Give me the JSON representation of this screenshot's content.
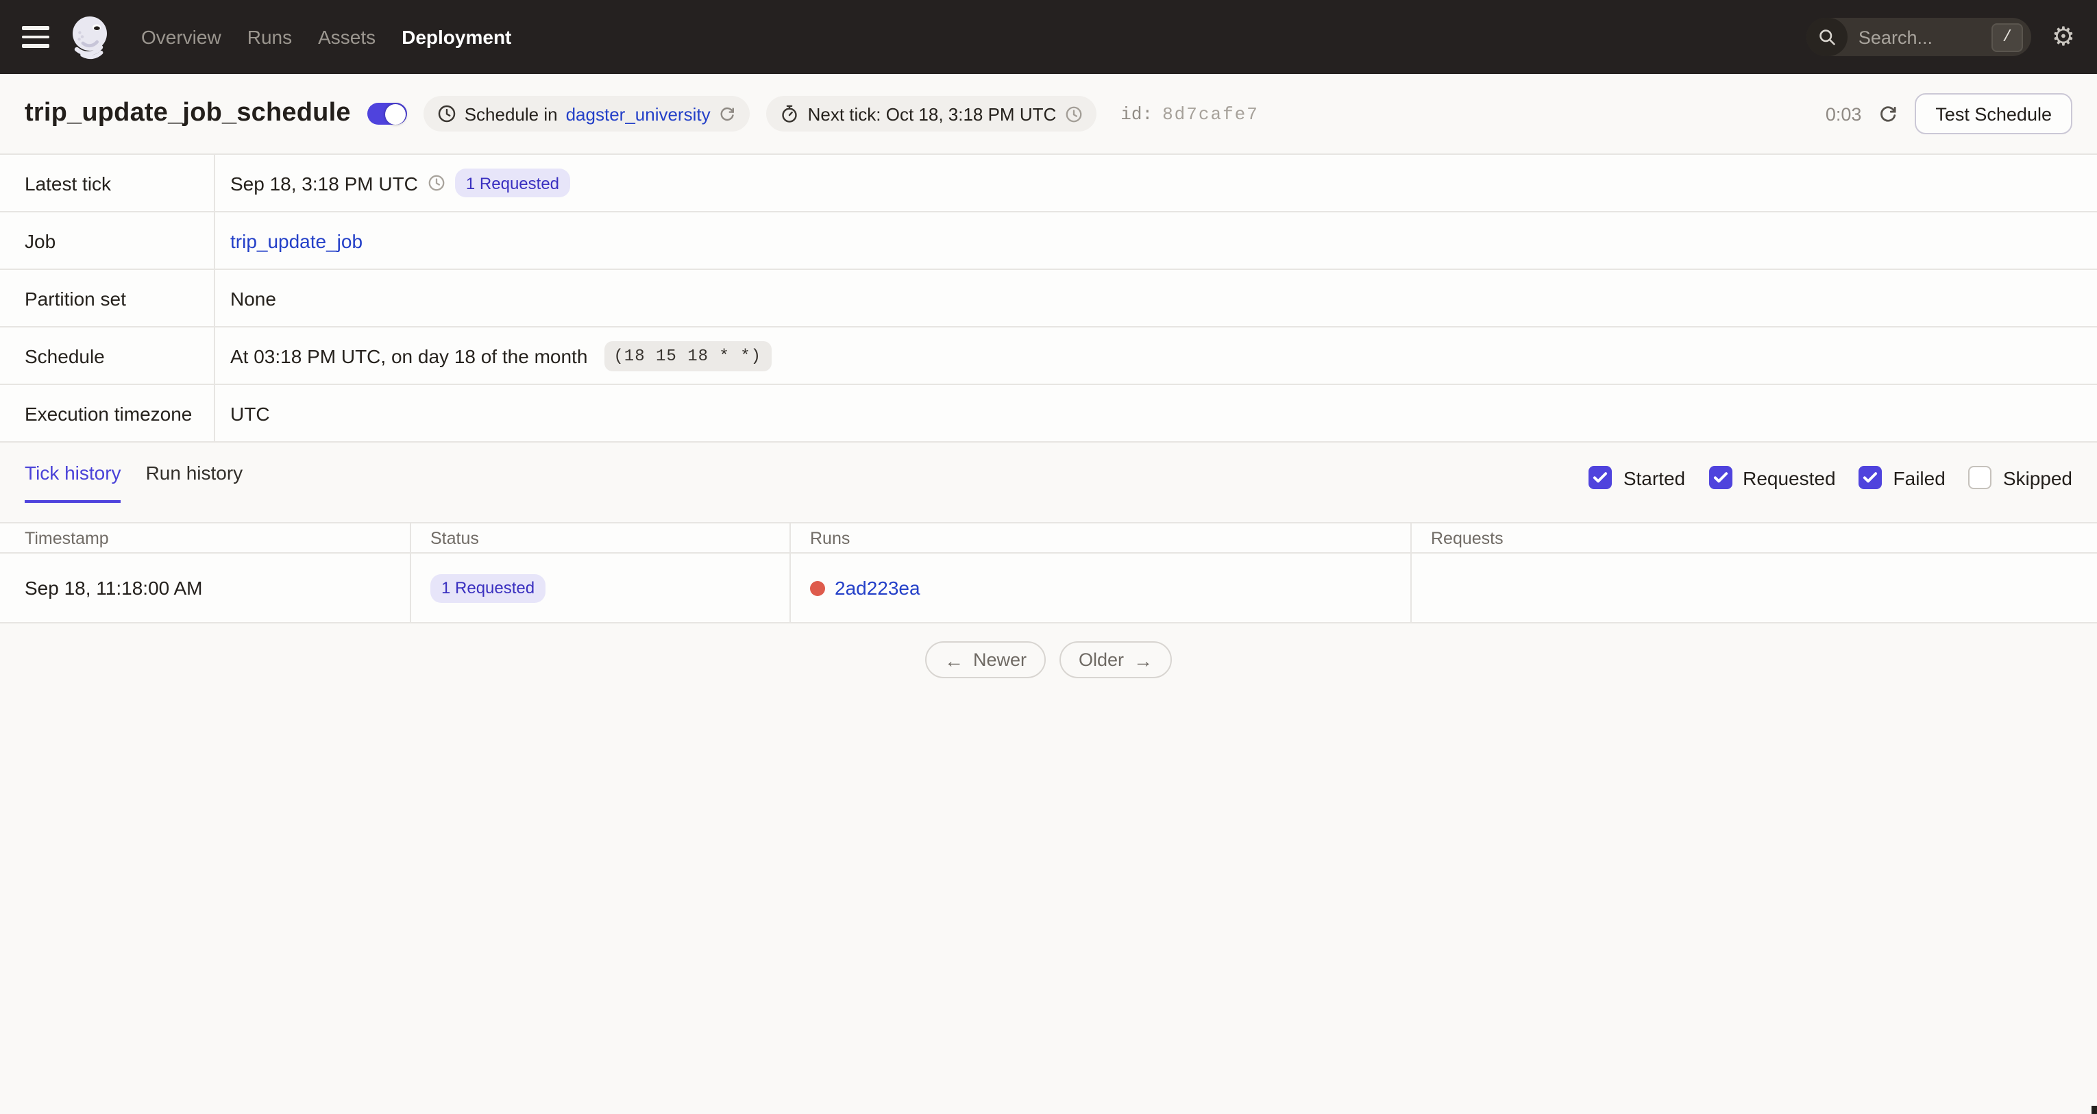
{
  "colors": {
    "navbar-bg": "#252120",
    "accent": "#4F43DD",
    "link": "#2440C8",
    "badge-bg": "#E7E5F9",
    "badge-text": "#3A30C0",
    "failed-red": "#DE5B4C",
    "page-bg": "#FAF9F7",
    "border": "#E7E5E2",
    "text-dark": "#231F1B",
    "text-gray": "#716C66"
  },
  "icons": {
    "settings": "⚙",
    "arrow_left": "←",
    "arrow_right": "→"
  },
  "nav": {
    "items": [
      {
        "label": "Overview",
        "active": false
      },
      {
        "label": "Runs",
        "active": false
      },
      {
        "label": "Assets",
        "active": false
      },
      {
        "label": "Deployment",
        "active": true
      }
    ],
    "search": {
      "placeholder": "Search...",
      "shortcut": "/"
    }
  },
  "header": {
    "title": "trip_update_job_schedule",
    "toggle": {
      "on": true
    },
    "schedule_pill": {
      "prefix": "Schedule in",
      "location": "dagster_university"
    },
    "next_tick_pill": {
      "text": "Next tick: Oct 18, 3:18 PM UTC"
    },
    "id_label": "id:",
    "id_value": "8d7cafe7",
    "countdown": "0:03",
    "test_button": "Test Schedule"
  },
  "details": {
    "latest_tick": {
      "label": "Latest tick",
      "time": "Sep 18, 3:18 PM UTC",
      "badge": "1 Requested"
    },
    "job": {
      "label": "Job",
      "link": "trip_update_job"
    },
    "partition_set": {
      "label": "Partition set",
      "value": "None"
    },
    "schedule": {
      "label": "Schedule",
      "text": "At 03:18 PM UTC, on day 18 of the month",
      "cron": "(18 15 18 * *)"
    },
    "timezone": {
      "label": "Execution timezone",
      "value": "UTC"
    }
  },
  "tabs": [
    {
      "label": "Tick history",
      "active": true
    },
    {
      "label": "Run history",
      "active": false
    }
  ],
  "filters": [
    {
      "label": "Started",
      "checked": true
    },
    {
      "label": "Requested",
      "checked": true
    },
    {
      "label": "Failed",
      "checked": true
    },
    {
      "label": "Skipped",
      "checked": false
    }
  ],
  "tick_table": {
    "columns": [
      "Timestamp",
      "Status",
      "Runs",
      "Requests"
    ],
    "rows": [
      {
        "timestamp": "Sep 18, 11:18:00 AM",
        "status_badge": "1 Requested",
        "run_id": "2ad223ea",
        "run_status": "failed",
        "requests": ""
      }
    ]
  },
  "pagination": {
    "newer": "Newer",
    "older": "Older"
  }
}
